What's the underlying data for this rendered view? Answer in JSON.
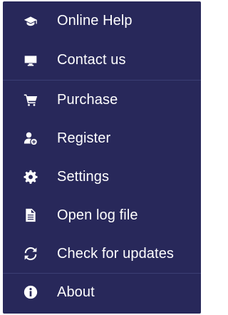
{
  "menu": {
    "items": [
      {
        "label": "Online Help",
        "icon": "graduation-cap-icon"
      },
      {
        "label": "Contact us",
        "icon": "monitor-icon"
      },
      {
        "label": "Purchase",
        "icon": "shopping-cart-icon"
      },
      {
        "label": "Register",
        "icon": "user-add-icon"
      },
      {
        "label": "Settings",
        "icon": "gear-icon"
      },
      {
        "label": "Open log file",
        "icon": "file-icon"
      },
      {
        "label": "Check for updates",
        "icon": "refresh-icon"
      },
      {
        "label": "About",
        "icon": "info-icon"
      }
    ]
  },
  "colors": {
    "background": "#28285a",
    "divider": "#3b3f73",
    "text": "#ffffff"
  }
}
